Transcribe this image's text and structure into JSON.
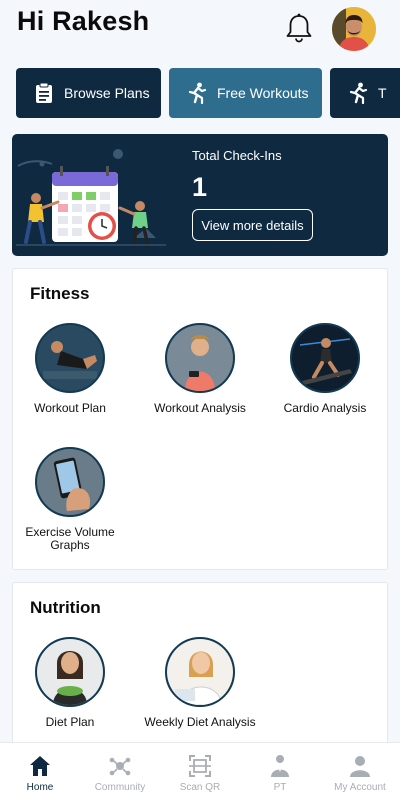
{
  "header": {
    "greeting": "Hi Rakesh"
  },
  "tabs": [
    {
      "label": "Browse Plans",
      "icon": "clipboard-icon"
    },
    {
      "label": "Free Workouts",
      "icon": "running-person-icon"
    },
    {
      "label": "T",
      "icon": "running-person-icon"
    }
  ],
  "checkin": {
    "label": "Total Check-Ins",
    "value": "1",
    "button_label": "View more details"
  },
  "fitness": {
    "title": "Fitness",
    "items": [
      {
        "label": "Workout Plan"
      },
      {
        "label": "Workout Analysis"
      },
      {
        "label": "Cardio Analysis"
      },
      {
        "label": "Exercise Volume Graphs"
      }
    ]
  },
  "nutrition": {
    "title": "Nutrition",
    "items": [
      {
        "label": "Diet Plan"
      },
      {
        "label": "Weekly Diet Analysis"
      }
    ]
  },
  "bottom_nav": {
    "items": [
      {
        "label": "Home",
        "active": true
      },
      {
        "label": "Community"
      },
      {
        "label": "Scan QR"
      },
      {
        "label": "PT"
      },
      {
        "label": "My Account"
      }
    ]
  },
  "colors": {
    "navy": "#0f2a40",
    "teal_tab": "#2f6d8f",
    "inactive_nav": "#a9adb4"
  }
}
